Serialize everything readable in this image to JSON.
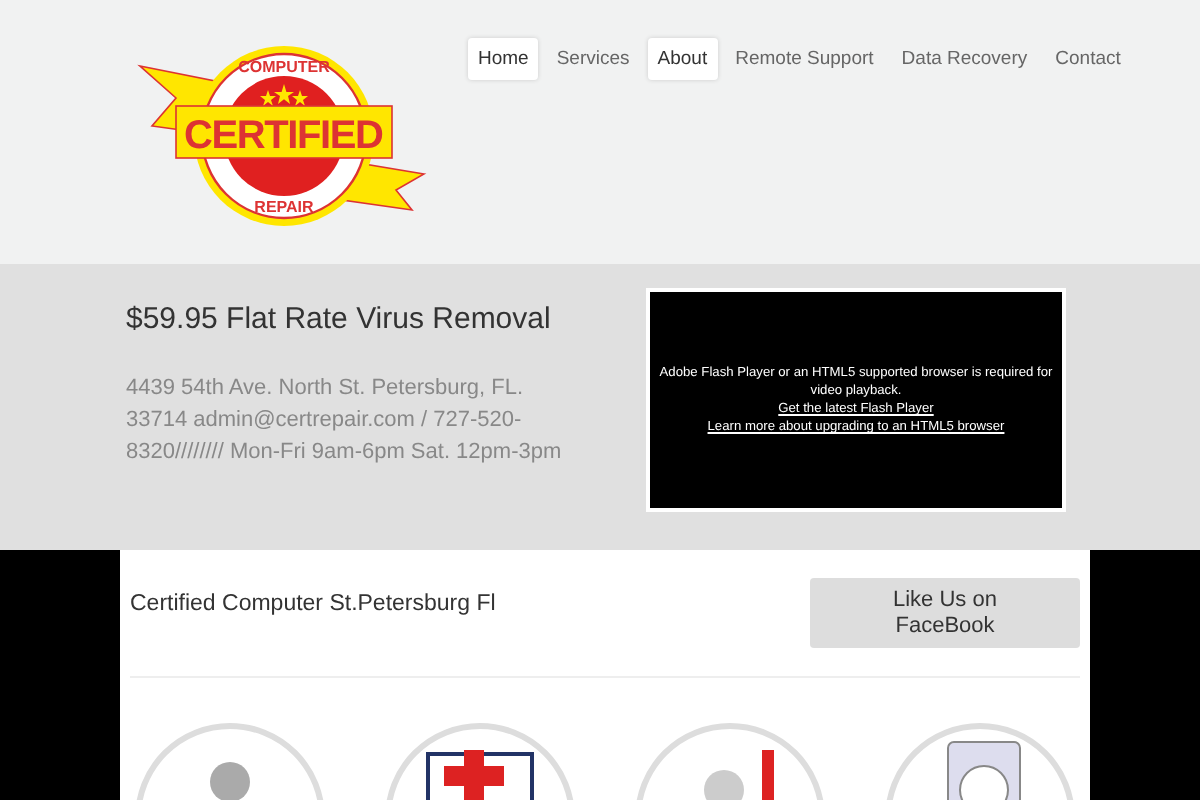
{
  "logo": {
    "top_text": "COMPUTER",
    "main_text": "CERTIFIED",
    "bottom_text": "REPAIR"
  },
  "nav": [
    {
      "label": "Home",
      "selected": true
    },
    {
      "label": "Services",
      "selected": false
    },
    {
      "label": "About",
      "selected": true
    },
    {
      "label": "Remote Support",
      "selected": false
    },
    {
      "label": "Data Recovery",
      "selected": false
    },
    {
      "label": "Contact",
      "selected": false
    }
  ],
  "hero": {
    "title": "$59.95 Flat Rate Virus Removal",
    "address": "4439 54th Ave. North St. Petersburg, FL. 33714 admin@certrepair.com / 727-520-8320//////// Mon-Fri 9am-6pm Sat. 12pm-3pm",
    "video": {
      "message": "Adobe Flash Player or an HTML5 supported browser is required for video playback.",
      "links": [
        "Get the latest Flash Player",
        "Learn more about upgrading to an HTML5 browser"
      ]
    }
  },
  "panel": {
    "heading": "Certified Computer St.Petersburg Fl",
    "button": "Like Us on FaceBook",
    "features": [
      {
        "kind": "person"
      },
      {
        "kind": "medical"
      },
      {
        "kind": "repair"
      },
      {
        "kind": "disk"
      }
    ]
  }
}
